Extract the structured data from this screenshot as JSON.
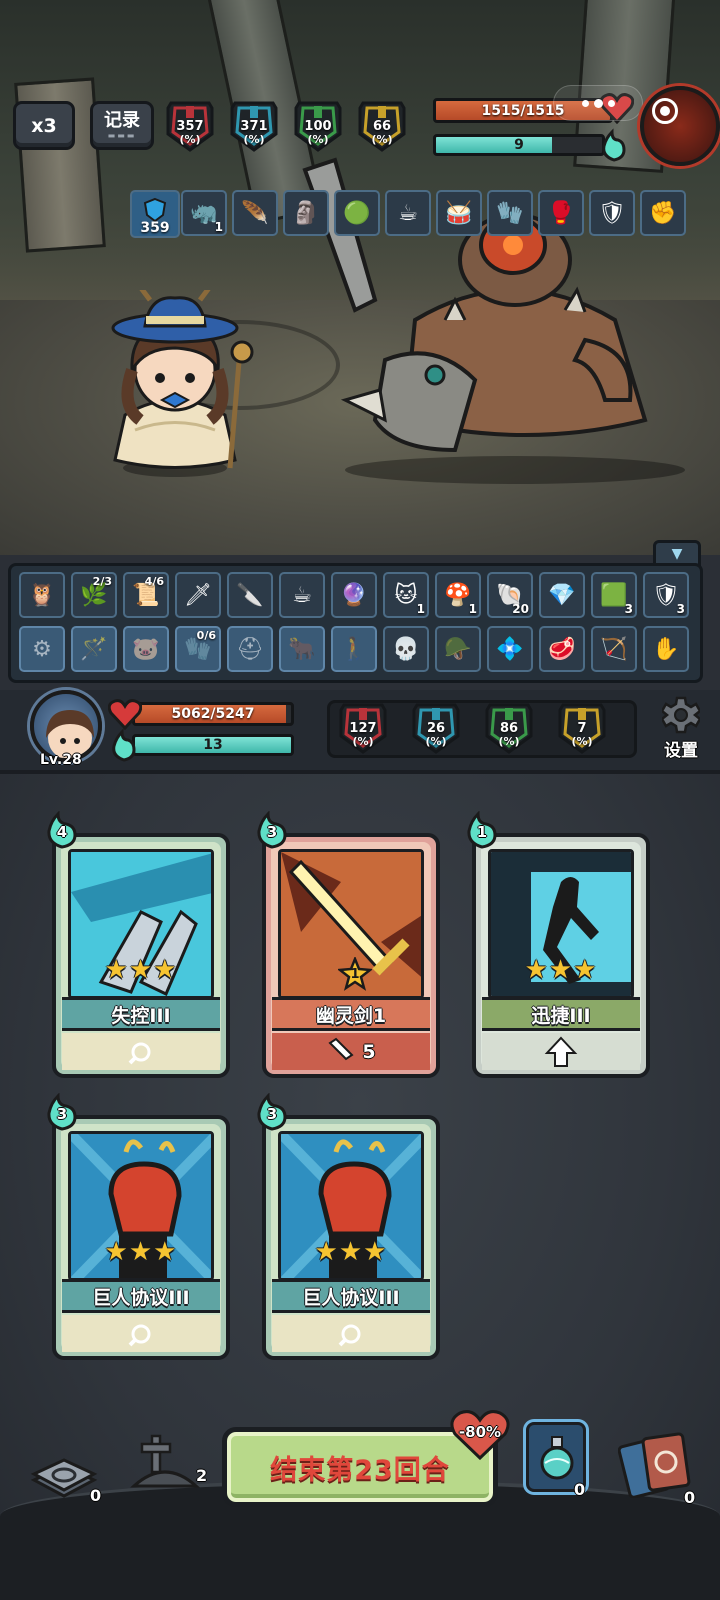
{
  "top_buttons": {
    "speed": "x3",
    "record": "记录"
  },
  "enemy": {
    "stats": [
      {
        "value": "357",
        "unit": "(%)",
        "icon": "attack-icon",
        "color": "#b8333a"
      },
      {
        "value": "371",
        "unit": "(%)",
        "icon": "mystery-icon",
        "color": "#2f97b0"
      },
      {
        "value": "100",
        "unit": "(%)",
        "icon": "defense-icon",
        "color": "#3a9a4a"
      },
      {
        "value": "66",
        "unit": "(%)",
        "icon": "speed-icon",
        "color": "#c7a12a"
      }
    ],
    "hp_text": "1515/1515",
    "hp_fraction": 1.0,
    "energy_text": "9",
    "energy_fraction": 0.7,
    "shield": "359",
    "status_effects": [
      {
        "icon": "rhino-helm-icon",
        "count": "1"
      },
      {
        "icon": "horn-icon",
        "count": ""
      },
      {
        "icon": "idol-icon",
        "count": ""
      },
      {
        "icon": "green-gem-icon",
        "count": ""
      },
      {
        "icon": "teacup-icon",
        "count": ""
      },
      {
        "icon": "drum-icon",
        "count": ""
      },
      {
        "icon": "bracer-icon",
        "count": ""
      },
      {
        "icon": "glove-icon",
        "count": ""
      },
      {
        "icon": "spiked-pauldron-icon",
        "count": ""
      },
      {
        "icon": "gauntlet-icon",
        "count": ""
      }
    ]
  },
  "inventory": {
    "row1": [
      {
        "icon": "owl-icon",
        "label": ""
      },
      {
        "icon": "plant-icon",
        "label": "2/3"
      },
      {
        "icon": "scroll-icon",
        "label": "4/6"
      },
      {
        "icon": "dagger-icon",
        "label": ""
      },
      {
        "icon": "red-blade-icon",
        "label": ""
      },
      {
        "icon": "teacup-icon",
        "label": ""
      },
      {
        "icon": "crystal-ball-icon",
        "label": ""
      },
      {
        "icon": "cat-icon",
        "count": "1"
      },
      {
        "icon": "mushroom-icon",
        "count": "1"
      },
      {
        "icon": "spiral-shell-icon",
        "count": "20"
      },
      {
        "icon": "red-crystal-icon",
        "count": ""
      },
      {
        "icon": "slime-icon",
        "count": "3"
      },
      {
        "icon": "blue-shield-icon",
        "count": "3"
      }
    ],
    "row2": [
      {
        "icon": "locked-ring-icon",
        "label": ""
      },
      {
        "icon": "locked-wand-icon",
        "label": ""
      },
      {
        "icon": "locked-pig-icon",
        "label": ""
      },
      {
        "icon": "locked-glove-icon",
        "label": "0/6"
      },
      {
        "icon": "locked-helm-icon",
        "label": ""
      },
      {
        "icon": "locked-bull-icon",
        "label": ""
      },
      {
        "icon": "locked-figure-icon",
        "label": ""
      },
      {
        "icon": "skull-cap-icon",
        "label": ""
      },
      {
        "icon": "spartan-helm-icon",
        "label": ""
      },
      {
        "icon": "crystals-icon",
        "label": ""
      },
      {
        "icon": "meat-icon",
        "label": ""
      },
      {
        "icon": "crossbow-icon",
        "label": ""
      },
      {
        "icon": "fist-glove-icon",
        "label": ""
      }
    ]
  },
  "player": {
    "level": "Lv.28",
    "hp_text": "5062/5247",
    "hp_fraction": 0.965,
    "energy_text": "13",
    "energy_fraction": 1.0,
    "stats": [
      {
        "value": "127",
        "unit": "(%)",
        "icon": "attack-icon",
        "color": "#b8333a"
      },
      {
        "value": "26",
        "unit": "(%)",
        "icon": "mystery-icon",
        "color": "#2f97b0"
      },
      {
        "value": "86",
        "unit": "(%)",
        "icon": "defense-icon",
        "color": "#3a9a4a"
      },
      {
        "value": "7",
        "unit": "(%)",
        "icon": "speed-icon",
        "color": "#c7a12a"
      }
    ],
    "settings_label": "设置"
  },
  "cards": [
    {
      "cost": "4",
      "name": "失控III",
      "stars": "★★★",
      "art": "claw-art-icon",
      "frame": "teal",
      "footer_icon": "gear-burst-icon",
      "footer_value": ""
    },
    {
      "cost": "3",
      "name": "幽灵剑1",
      "stars": "",
      "level_star": "1",
      "art": "sword-art-icon",
      "frame": "red",
      "footer_icon": "blade-icon",
      "footer_value": "5"
    },
    {
      "cost": "1",
      "name": "迅捷III",
      "stars": "★★★",
      "art": "runner-art-icon",
      "frame": "green",
      "footer_icon": "arrow-up-icon",
      "footer_value": ""
    },
    {
      "cost": "3",
      "name": "巨人协议III",
      "stars": "★★★",
      "art": "fist-art-icon",
      "frame": "teal",
      "footer_icon": "gear-burst-icon",
      "footer_value": ""
    },
    {
      "cost": "3",
      "name": "巨人协议III",
      "stars": "★★★",
      "art": "fist-art-icon",
      "frame": "teal",
      "footer_icon": "gear-burst-icon",
      "footer_value": ""
    }
  ],
  "bottom": {
    "draw_pile_count": "0",
    "grave_count": "2",
    "end_turn_label": "结束第23回合",
    "discount_badge": "-80%",
    "potion_count": "0",
    "discard_count": "0"
  }
}
